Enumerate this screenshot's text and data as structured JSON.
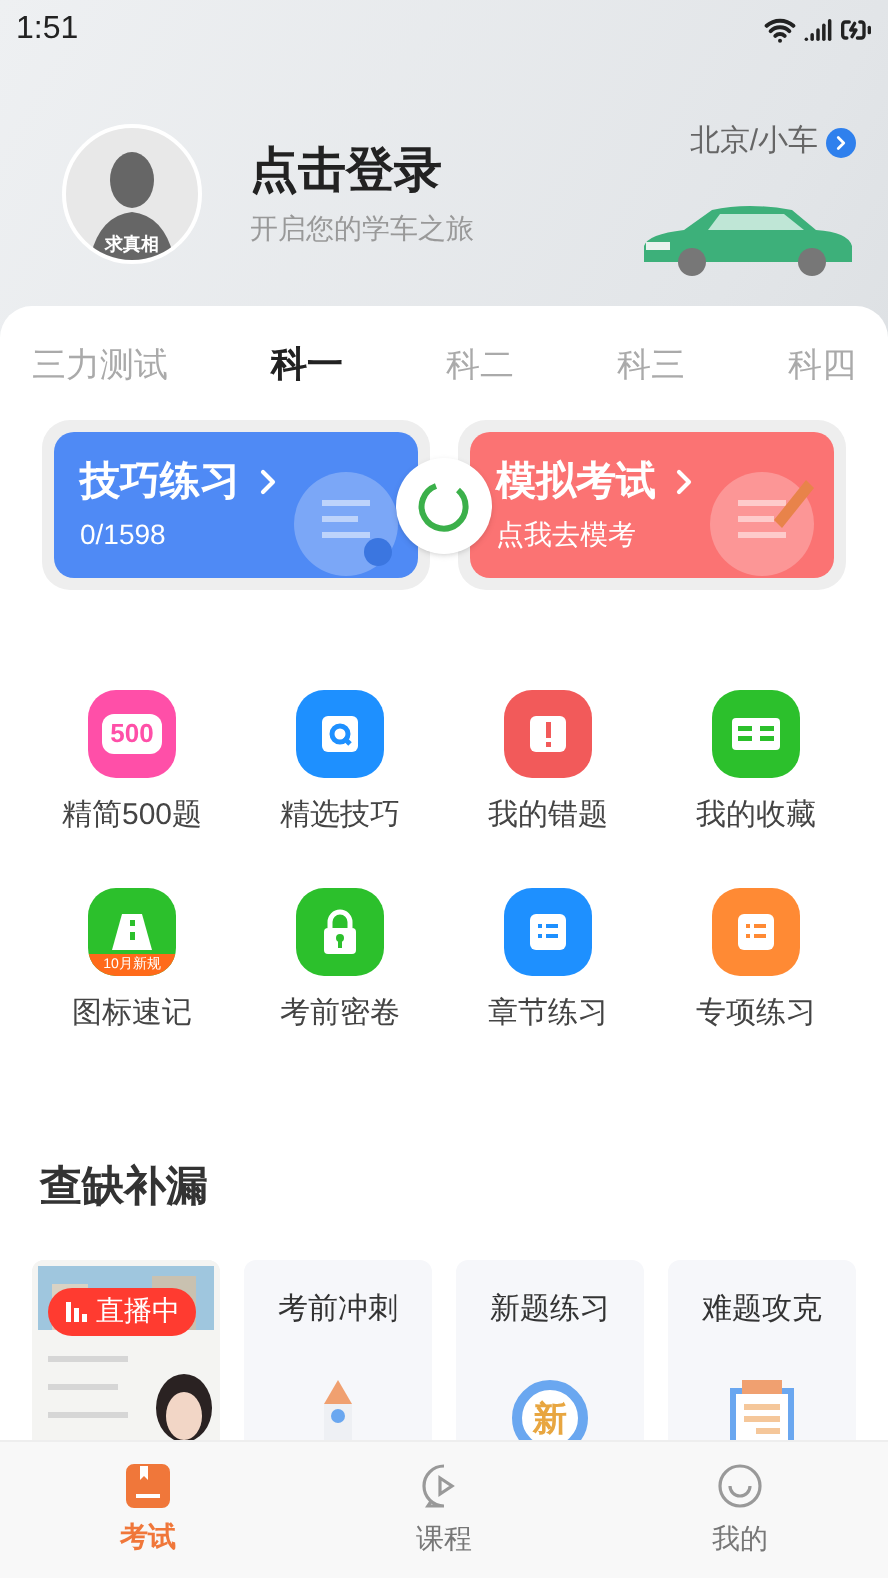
{
  "status_bar": {
    "time": "1:51"
  },
  "profile": {
    "avatar_badge": "求真相",
    "title": "点击登录",
    "subtitle": "开启您的学车之旅",
    "location": "北京/小车"
  },
  "tabs": [
    {
      "label": "三力测试",
      "selected": false
    },
    {
      "label": "科一",
      "selected": true
    },
    {
      "label": "科二",
      "selected": false
    },
    {
      "label": "科三",
      "selected": false
    },
    {
      "label": "科四",
      "selected": false
    }
  ],
  "feature_cards": [
    {
      "kind": "practice",
      "title": "技巧练习",
      "subtitle": "0/1598"
    },
    {
      "kind": "exam",
      "title": "模拟考试",
      "subtitle": "点我去模考"
    }
  ],
  "shortcuts": [
    {
      "kind": "count",
      "label": "精简500题",
      "icon_text": "500"
    },
    {
      "kind": "search",
      "label": "精选技巧"
    },
    {
      "kind": "alert",
      "label": "我的错题"
    },
    {
      "kind": "book",
      "label": "我的收藏"
    },
    {
      "kind": "road",
      "label": "图标速记",
      "icon_text": "10月新规"
    },
    {
      "kind": "lock",
      "label": "考前密卷"
    },
    {
      "kind": "list-blue",
      "label": "章节练习"
    },
    {
      "kind": "list-orange",
      "label": "专项练习"
    }
  ],
  "section_title": "查缺补漏",
  "review_cards": [
    {
      "kind": "live",
      "badge": "直播中"
    },
    {
      "kind": "rocket",
      "title": "考前冲刺"
    },
    {
      "kind": "new",
      "title": "新题练习",
      "icon_text": "新"
    },
    {
      "kind": "clipboard",
      "title": "难题攻克"
    }
  ],
  "bottom_nav": [
    {
      "kind": "book",
      "label": "考试",
      "selected": true
    },
    {
      "kind": "play",
      "label": "课程",
      "selected": false
    },
    {
      "kind": "smile",
      "label": "我的",
      "selected": false
    }
  ]
}
